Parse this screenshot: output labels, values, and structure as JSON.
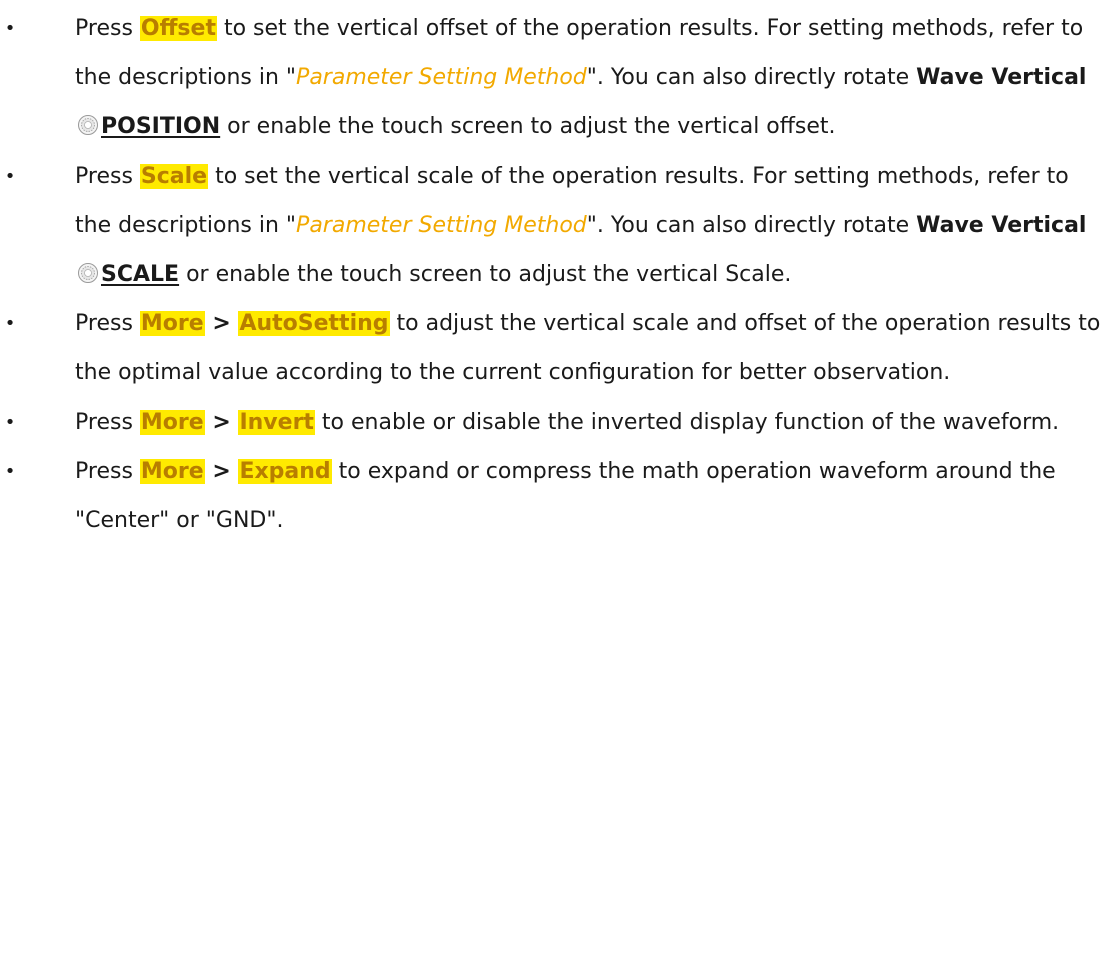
{
  "bullets": [
    {
      "p1": "Press ",
      "btn": "Offset",
      "p2": " to set the vertical offset of the operation results. For setting methods, refer to the descriptions in \"",
      "link": "Parameter Setting Method",
      "p3": "\". You can also directly rotate ",
      "ctrl": "Wave Vertical",
      "knob_icon": "knob-icon",
      "knob_label": "POSITION",
      "p4": " or enable the touch screen to adjust the vertical offset."
    },
    {
      "p1": "Press ",
      "btn": "Scale",
      "p2": " to set the vertical scale of the operation results. For setting methods, refer to the descriptions in \"",
      "link": "Parameter Setting Method",
      "p3": "\". You can also directly rotate ",
      "ctrl": "Wave Vertical",
      "knob_icon": "knob-icon",
      "knob_label": "SCALE",
      "p4": " or enable the touch screen to adjust the vertical Scale."
    },
    {
      "p1": "Press ",
      "btn1": "More",
      "sep": " > ",
      "btn2": "AutoSetting",
      "p2": " to adjust the vertical scale and offset of the operation results to the optimal value according to the current configuration for better observation."
    },
    {
      "p1": "Press ",
      "btn1": "More",
      "sep": " > ",
      "btn2": "Invert",
      "p2": " to enable or disable the inverted display function of the waveform."
    },
    {
      "p1": "Press ",
      "btn1": "More",
      "sep": " > ",
      "btn2": "Expand",
      "p2": " to expand or compress the math operation waveform around the \"Center\" or \"GND\"."
    }
  ],
  "bullet_char": "•"
}
